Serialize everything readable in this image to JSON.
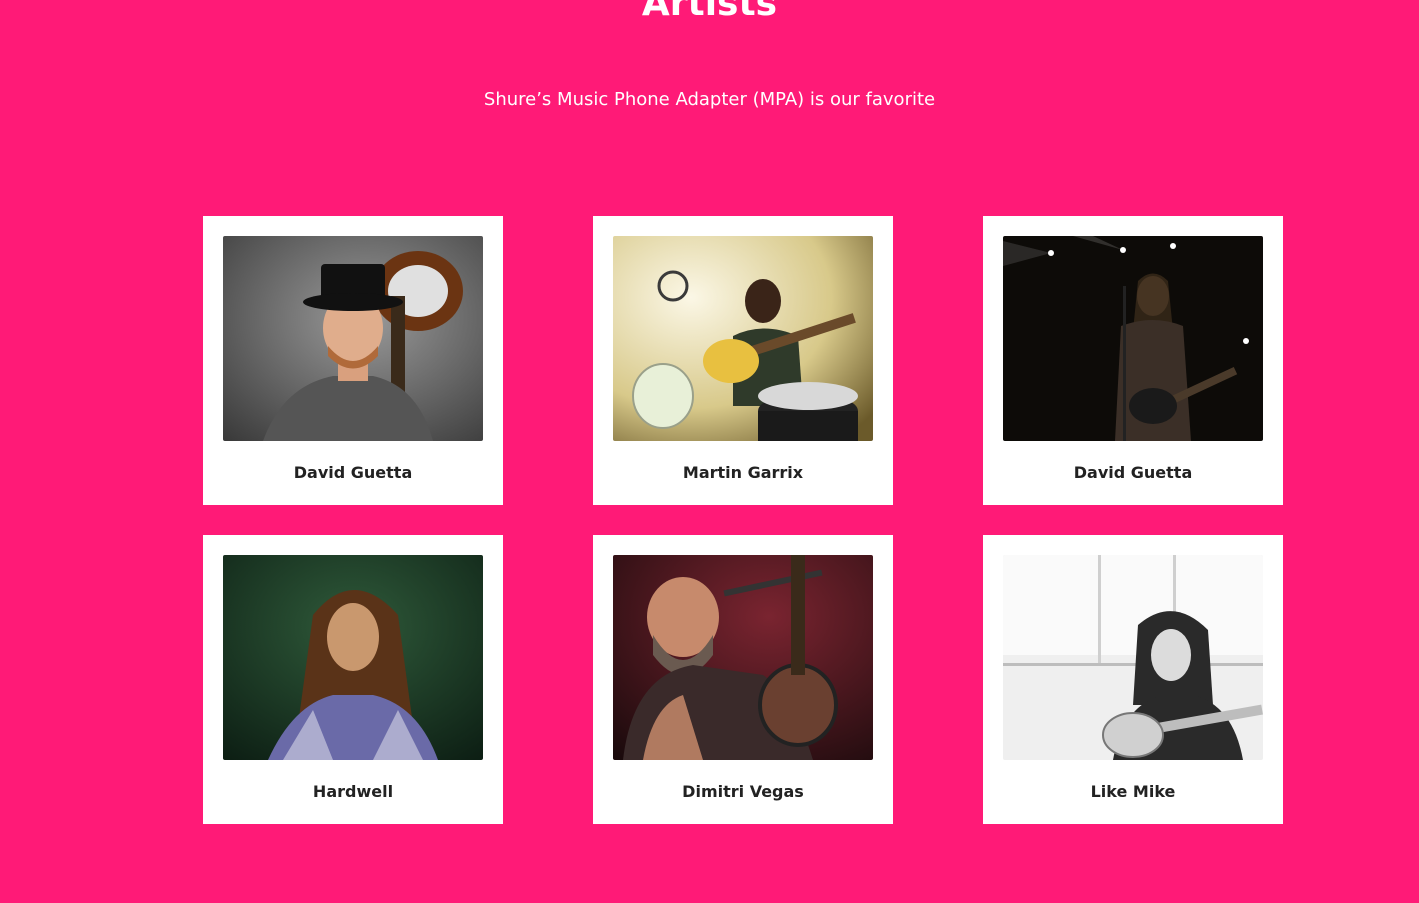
{
  "section": {
    "title": "Artists",
    "subtitle": "Shure’s Music Phone Adapter (MPA) is our favorite"
  },
  "artists": [
    {
      "name": "David Guetta"
    },
    {
      "name": "Martin Garrix"
    },
    {
      "name": "David Guetta"
    },
    {
      "name": "Hardwell"
    },
    {
      "name": "Dimitri Vegas"
    },
    {
      "name": "Like Mike"
    }
  ],
  "colors": {
    "background": "#ff1a77",
    "card": "#ffffff",
    "name_text": "#222222"
  }
}
